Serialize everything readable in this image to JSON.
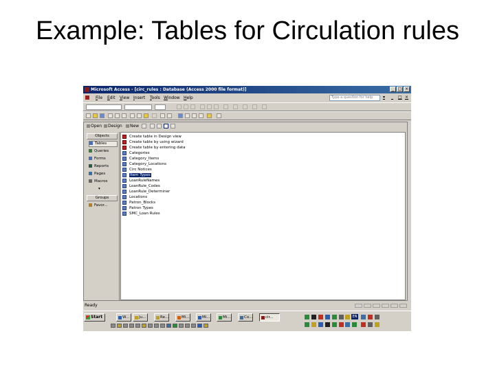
{
  "slide": {
    "title": "Example: Tables for Circulation rules"
  },
  "window": {
    "title": "Microsoft Access - [circ_rules : Database (Access 2000 file format)]"
  },
  "menubar": {
    "items": [
      "File",
      "Edit",
      "View",
      "Insert",
      "Tools",
      "Window",
      "Help"
    ],
    "help_placeholder": "Type a question for help"
  },
  "db_toolbar": {
    "open": "Open",
    "design": "Design",
    "new": "New"
  },
  "sidebar": {
    "objects_header": "Objects",
    "items": [
      {
        "label": "Tables",
        "icon": "table-icon",
        "active": true
      },
      {
        "label": "Queries",
        "icon": "query-icon"
      },
      {
        "label": "Forms",
        "icon": "form-icon"
      },
      {
        "label": "Reports",
        "icon": "report-icon"
      },
      {
        "label": "Pages",
        "icon": "page-icon"
      },
      {
        "label": "Macros",
        "icon": "macro-icon"
      }
    ],
    "groups_header": "Groups",
    "favorites": "Favor..."
  },
  "objects": {
    "items": [
      {
        "label": "Create table in Design view",
        "icon": "wizard-icon"
      },
      {
        "label": "Create table by using wizard",
        "icon": "wizard-icon"
      },
      {
        "label": "Create table by entering data",
        "icon": "wizard-icon"
      },
      {
        "label": "Categories",
        "icon": "table-icon"
      },
      {
        "label": "Category_Items",
        "icon": "table-icon"
      },
      {
        "label": "Category_Locations",
        "icon": "table-icon"
      },
      {
        "label": "Circ Notices",
        "icon": "table-icon"
      },
      {
        "label": "Item Types",
        "icon": "table-icon",
        "selected": true
      },
      {
        "label": "LoanRuleNames",
        "icon": "table-icon"
      },
      {
        "label": "LoanRule_Codes",
        "icon": "table-icon"
      },
      {
        "label": "LoanRule_Determiner",
        "icon": "table-icon"
      },
      {
        "label": "Locations",
        "icon": "table-icon"
      },
      {
        "label": "Patron_Blocks",
        "icon": "table-icon"
      },
      {
        "label": "Patron Types",
        "icon": "table-icon"
      },
      {
        "label": "SMC_Loan Rules",
        "icon": "table-icon"
      }
    ]
  },
  "statusbar": {
    "text": "Ready"
  },
  "taskbar": {
    "start": "Start",
    "tasks": [
      "W...",
      "Ju...",
      "Re...",
      "Mi...",
      "Mi...",
      "Mi...",
      "Co...",
      "cir..."
    ],
    "language": "EN"
  },
  "colors": {
    "titlebar": "#0a246a",
    "selection": "#0a246a",
    "chrome": "#d4d0c8"
  }
}
